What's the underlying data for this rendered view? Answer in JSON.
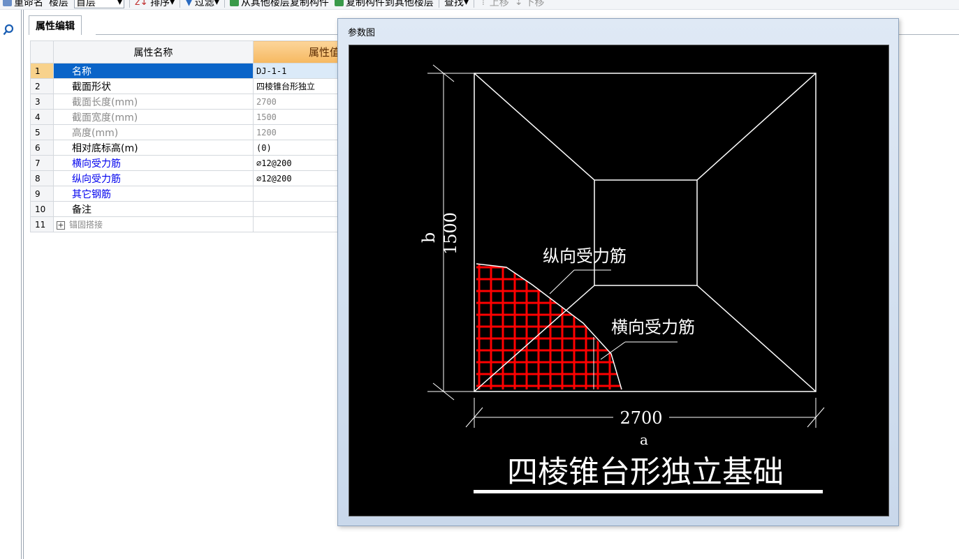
{
  "toolbar": {
    "rename_label": "重命名",
    "floor_label": "楼层",
    "floor_value": "首层",
    "sort_label": "排序",
    "filter_label": "过滤",
    "copy_from_label": "从其他楼层复制构件",
    "copy_to_label": "复制构件到其他楼层",
    "find_label": "查找",
    "move_up_label": "上移",
    "move_down_label": "下移"
  },
  "tab": {
    "label": "属性编辑"
  },
  "grid": {
    "header_name": "属性名称",
    "header_value": "属性值",
    "rows": [
      {
        "num": "1",
        "name": "名称",
        "value": "DJ-1-1"
      },
      {
        "num": "2",
        "name": "截面形状",
        "value": "四棱锥台形独立"
      },
      {
        "num": "3",
        "name": "截面长度(mm)",
        "value": "2700"
      },
      {
        "num": "4",
        "name": "截面宽度(mm)",
        "value": "1500"
      },
      {
        "num": "5",
        "name": "高度(mm)",
        "value": "1200"
      },
      {
        "num": "6",
        "name": "相对底标高(m)",
        "value": "(0)"
      },
      {
        "num": "7",
        "name": "横向受力筋",
        "value": "⌀12@200"
      },
      {
        "num": "8",
        "name": "纵向受力筋",
        "value": "⌀12@200"
      },
      {
        "num": "9",
        "name": "其它钢筋",
        "value": ""
      },
      {
        "num": "10",
        "name": "备注",
        "value": ""
      },
      {
        "num": "11",
        "name": "锚固搭接",
        "value": ""
      }
    ]
  },
  "dialog": {
    "title": "参数图",
    "diagram": {
      "dim_width": "2700",
      "dim_width_symbol": "a",
      "dim_height": "1500",
      "dim_height_symbol": "b",
      "label_longitudinal": "纵向受力筋",
      "label_transverse": "横向受力筋",
      "caption": "四棱锥台形独立基础"
    }
  },
  "colors": {
    "selected_row": "#0a64c8",
    "value_header": "#f6b860",
    "link_text": "#0000ee",
    "rebar": "#ff0000",
    "canvas_bg": "#000000"
  }
}
